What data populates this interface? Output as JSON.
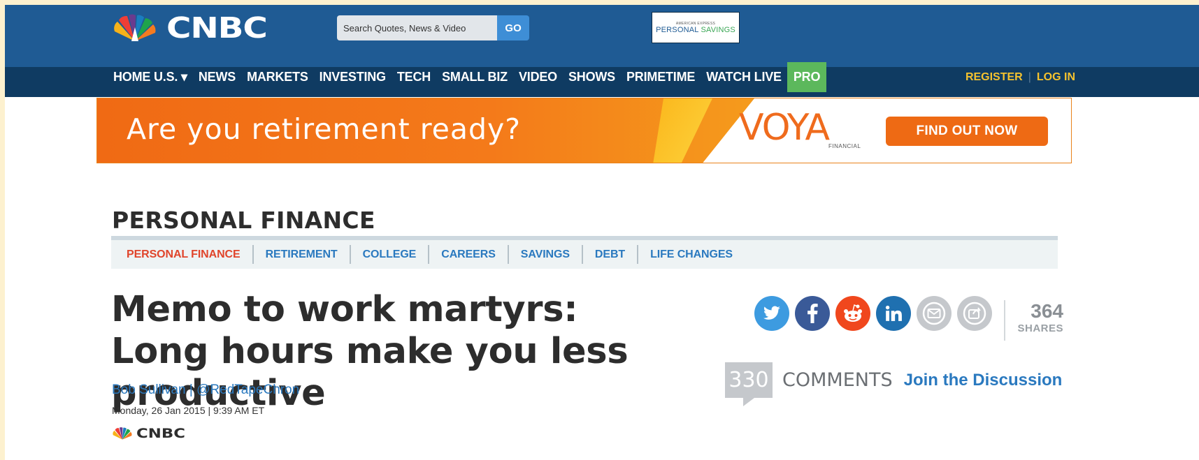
{
  "header": {
    "brand": "CNBC",
    "search": {
      "placeholder": "Search Quotes, News & Video",
      "go_label": "GO"
    },
    "sponsor": {
      "small": "AMERICAN EXPRESS",
      "word1": "PERSONAL",
      "word2": "SAVINGS"
    }
  },
  "nav": {
    "items": [
      "HOME U.S. ▾",
      "NEWS",
      "MARKETS",
      "INVESTING",
      "TECH",
      "SMALL BIZ",
      "VIDEO",
      "SHOWS",
      "PRIMETIME",
      "WATCH LIVE",
      "PRO"
    ],
    "register": "REGISTER",
    "login": "LOG IN",
    "divider": "|"
  },
  "ad": {
    "text": "Are you retirement ready?",
    "brand": "VOYA",
    "brand_sub": "FINANCIAL",
    "cta": "FIND OUT NOW"
  },
  "section": {
    "title": "PERSONAL FINANCE",
    "subnav": [
      "PERSONAL FINANCE",
      "RETIREMENT",
      "COLLEGE",
      "CAREERS",
      "SAVINGS",
      "DEBT",
      "LIFE CHANGES"
    ]
  },
  "article": {
    "headline": "Memo to work martyrs: Long hours make you less productive",
    "author": "Bob Sullivan",
    "handle": "@RedTapeChron",
    "separator": "|",
    "date": "Monday, 26 Jan 2015 | 9:39 AM ET",
    "source": "CNBC"
  },
  "share": {
    "count": "364",
    "label": "SHARES",
    "icons": [
      "twitter-icon",
      "facebook-icon",
      "reddit-icon",
      "linkedin-icon",
      "email-icon",
      "share-icon"
    ]
  },
  "comments": {
    "count": "330",
    "label": "COMMENTS",
    "join": "Join the Discussion"
  },
  "colors": {
    "header_blue": "#1f5b94",
    "nav_dark": "#0f3b62",
    "pro_green": "#5cb85c",
    "link_blue": "#2a79bf",
    "active_red": "#e0452b",
    "ad_orange": "#f06a14"
  }
}
